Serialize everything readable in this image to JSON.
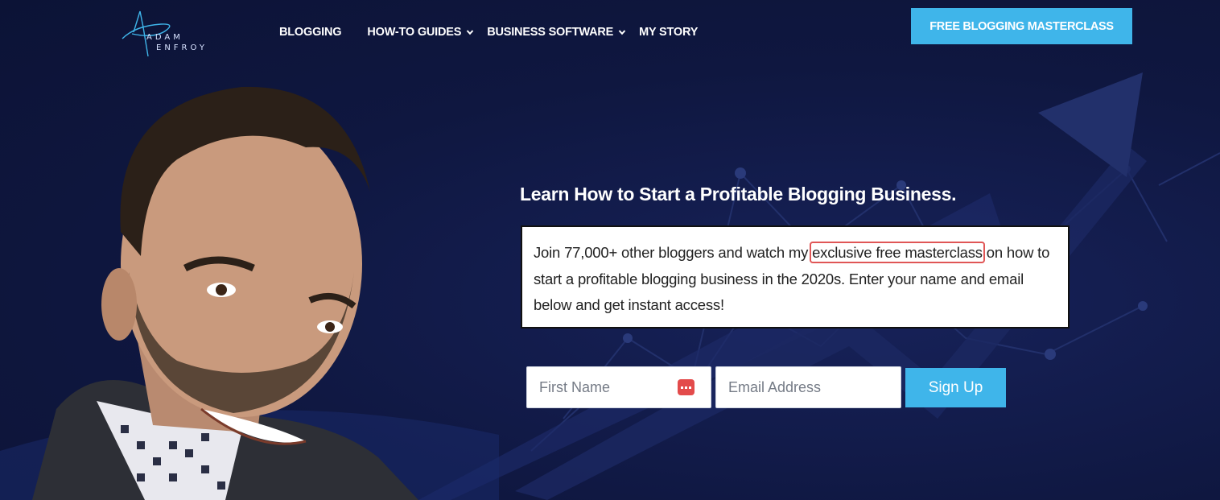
{
  "header": {
    "logo": {
      "line1": "ADAM",
      "line2": "ENFROY"
    },
    "nav": [
      {
        "label": "BLOGGING",
        "has_dropdown": false
      },
      {
        "label": "HOW-TO GUIDES",
        "has_dropdown": true
      },
      {
        "label": "BUSINESS SOFTWARE",
        "has_dropdown": true
      },
      {
        "label": "MY STORY",
        "has_dropdown": false
      }
    ],
    "cta_label": "FREE BLOGGING MASTERCLASS"
  },
  "hero": {
    "headline": "Learn How to Start a Profitable Blogging Business.",
    "intro": {
      "before": "Join 77,000+ other bloggers and watch my ",
      "highlight": "exclusive free masterclass",
      "after": " on how to start a profitable blogging business in the 2020s. Enter your name and email below and get instant access!"
    },
    "form": {
      "first_name_placeholder": "First Name",
      "email_placeholder": "Email Address",
      "submit_label": "Sign Up"
    }
  },
  "colors": {
    "background": "#0f1740",
    "accent": "#3fb5ea",
    "highlight_outline": "#e05656",
    "password_manager_icon": "#e34b4b"
  },
  "icons": [
    "logo-star-icon",
    "chevron-down-icon",
    "password-manager-icon"
  ]
}
